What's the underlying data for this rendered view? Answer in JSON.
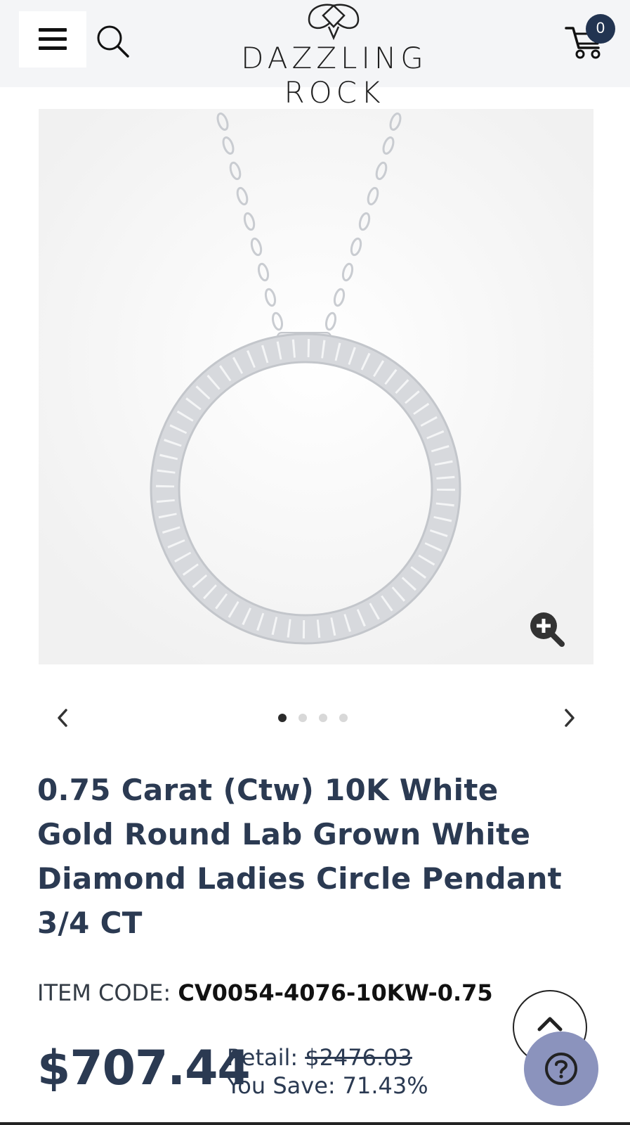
{
  "header": {
    "brand": "DAZZLING ROCK",
    "cart_count": "0",
    "icons": {
      "menu": "hamburger-menu-icon",
      "search": "search-icon",
      "cart": "shopping-cart-icon",
      "logo": "brand-logo-mark"
    }
  },
  "gallery": {
    "image_alt": "Circle pendant with diamonds on chain",
    "total_images": 4,
    "active_index": 0,
    "icons": {
      "zoom": "zoom-in-icon",
      "prev": "chevron-left-icon",
      "next": "chevron-right-icon"
    }
  },
  "product": {
    "title": "0.75 Carat (Ctw) 10K White Gold Round Lab Grown White Diamond Ladies Circle Pendant 3/4 CT",
    "item_code_label": "ITEM CODE:",
    "item_code": "CV0054-4076-10KW-0.75",
    "price": "$707.44",
    "retail_label": "Retail:",
    "retail_price": "$2476.03",
    "save_label": "You Save:",
    "save_percent": "71.43%"
  },
  "floating": {
    "icons": {
      "scroll_top": "chevron-up-icon",
      "help": "question-mark-icon"
    }
  },
  "colors": {
    "navy": "#2b3a52",
    "badge": "#223451",
    "help_bg": "#8b93bd",
    "header_bg": "#f4f5f7"
  }
}
